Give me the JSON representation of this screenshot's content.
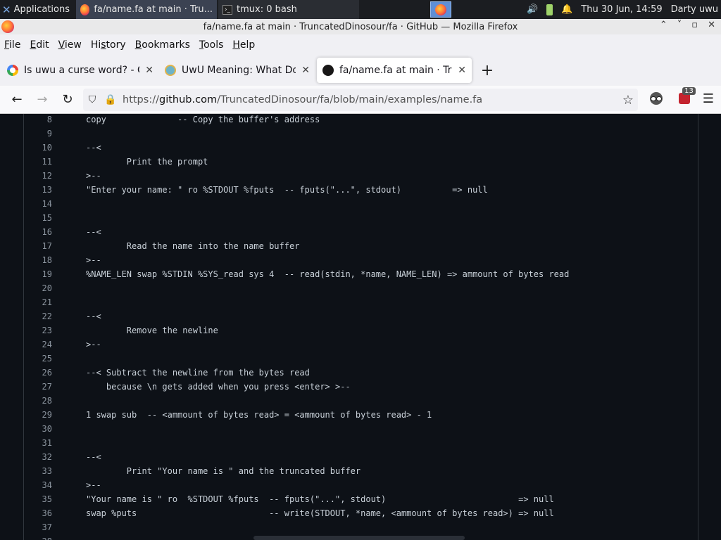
{
  "panel": {
    "apps_label": "Applications",
    "tasks": [
      {
        "title": "fa/name.fa at main · Tru..."
      },
      {
        "title": "tmux: 0 bash"
      }
    ],
    "clock": "Thu 30 Jun, 14:59",
    "user": "Darty uwu"
  },
  "window": {
    "title": "fa/name.fa at main · TruncatedDinosour/fa · GitHub — Mozilla Firefox"
  },
  "menu": {
    "items": [
      {
        "label": "File",
        "key": "F",
        "rest": "ile"
      },
      {
        "label": "Edit",
        "key": "E",
        "rest": "dit"
      },
      {
        "label": "View",
        "key": "V",
        "rest": "iew"
      },
      {
        "label": "History",
        "key": "s",
        "pre": "Hi",
        "rest": "tory"
      },
      {
        "label": "Bookmarks",
        "key": "B",
        "rest": "ookmarks"
      },
      {
        "label": "Tools",
        "key": "T",
        "rest": "ools"
      },
      {
        "label": "Help",
        "key": "H",
        "rest": "elp"
      }
    ]
  },
  "tabs": [
    {
      "label": "Is uwu a curse word? - Gr",
      "icon": "google-icon"
    },
    {
      "label": "UwU Meaning: What Doe",
      "icon": "smile-icon"
    },
    {
      "label": "fa/name.fa at main · Trun",
      "icon": "github-icon"
    }
  ],
  "nav": {
    "url_prefix": "https://",
    "url_domain": "github.com",
    "url_path": "/TruncatedDinosour/fa/blob/main/examples/name.fa",
    "extension_badge": "13"
  },
  "code": {
    "lines": [
      {
        "n": "8",
        "t": "copy              -- Copy the buffer's address"
      },
      {
        "n": "9",
        "t": ""
      },
      {
        "n": "10",
        "t": "--<"
      },
      {
        "n": "11",
        "t": "        Print the prompt"
      },
      {
        "n": "12",
        "t": ">--"
      },
      {
        "n": "13",
        "t": "\"Enter your name: \" ro %STDOUT %fputs  -- fputs(\"...\", stdout)          => null"
      },
      {
        "n": "14",
        "t": ""
      },
      {
        "n": "15",
        "t": ""
      },
      {
        "n": "16",
        "t": "--<"
      },
      {
        "n": "17",
        "t": "        Read the name into the name buffer"
      },
      {
        "n": "18",
        "t": ">--"
      },
      {
        "n": "19",
        "t": "%NAME_LEN swap %STDIN %SYS_read sys 4  -- read(stdin, *name, NAME_LEN) => ammount of bytes read"
      },
      {
        "n": "20",
        "t": ""
      },
      {
        "n": "21",
        "t": ""
      },
      {
        "n": "22",
        "t": "--<"
      },
      {
        "n": "23",
        "t": "        Remove the newline"
      },
      {
        "n": "24",
        "t": ">--"
      },
      {
        "n": "25",
        "t": ""
      },
      {
        "n": "26",
        "t": "--< Subtract the newline from the bytes read"
      },
      {
        "n": "27",
        "t": "    because \\n gets added when you press <enter> >--"
      },
      {
        "n": "28",
        "t": ""
      },
      {
        "n": "29",
        "t": "1 swap sub  -- <ammount of bytes read> = <ammount of bytes read> - 1"
      },
      {
        "n": "30",
        "t": ""
      },
      {
        "n": "31",
        "t": ""
      },
      {
        "n": "32",
        "t": "--<"
      },
      {
        "n": "33",
        "t": "        Print \"Your name is \" and the truncated buffer"
      },
      {
        "n": "34",
        "t": ">--"
      },
      {
        "n": "35",
        "t": "\"Your name is \" ro  %STDOUT %fputs  -- fputs(\"...\", stdout)                          => null"
      },
      {
        "n": "36",
        "t": "swap %puts                          -- write(STDOUT, *name, <ammount of bytes read>) => null"
      },
      {
        "n": "37",
        "t": ""
      },
      {
        "n": "38",
        "t": ""
      }
    ]
  }
}
